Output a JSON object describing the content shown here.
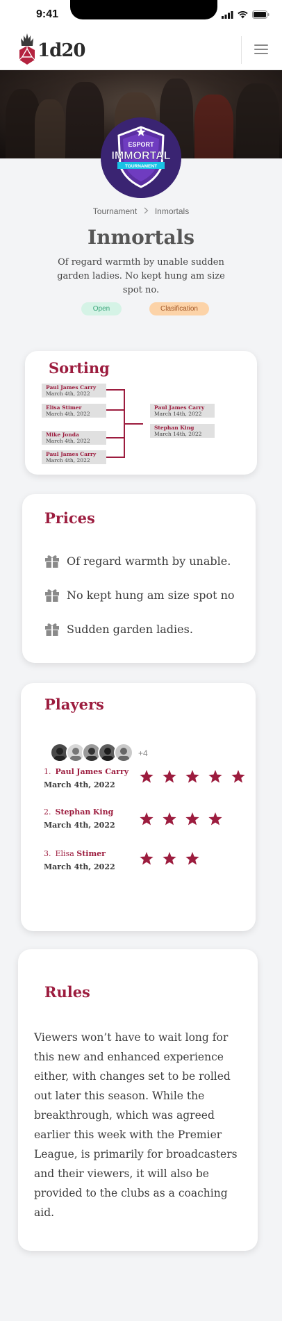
{
  "status_bar": {
    "time": "9:41"
  },
  "header": {
    "logo_text": "1d20",
    "menu_icon": "hamburger-menu-icon"
  },
  "breadcrumb": {
    "parent": "Tournament",
    "current": "Inmortals"
  },
  "team": {
    "name": "Inmortals",
    "description": "Of regard warmth by unable sudden garden ladies. No kept hung am size spot no.",
    "logo": {
      "top": "ESPORT",
      "main": "IMMORTAL",
      "bottom": "TOURNAMENT"
    }
  },
  "badges": {
    "open": "Open",
    "classification": "Clasification"
  },
  "sorting": {
    "title": "Sorting",
    "round1": [
      {
        "name": "Paul James Carry",
        "date": "March 4th, 2022"
      },
      {
        "name": "Elisa Stimer",
        "date": "March 4th, 2022"
      },
      {
        "name": "Mike Jonda",
        "date": "March 4th, 2022"
      },
      {
        "name": "Paul James Carry",
        "date": "March 4th, 2022"
      }
    ],
    "round2": [
      {
        "name": "Paul James Carry",
        "date": "March 14th, 2022"
      },
      {
        "name": "Stephan King",
        "date": "March 14th, 2022"
      }
    ]
  },
  "prices": {
    "title": "Prices",
    "items": [
      "Of regard warmth by unable.",
      "No kept hung am size spot no",
      "Sudden garden ladies."
    ],
    "icon": "gift-icon"
  },
  "players": {
    "title": "Players",
    "more_count": "+4",
    "list": [
      {
        "rank": "1.",
        "first": "Paul",
        "rest": "James Carry",
        "date": "March 4th, 2022",
        "stars": 5
      },
      {
        "rank": "2.",
        "first": "Stephan",
        "rest": "King",
        "date": "March 4th, 2022",
        "stars": 4
      },
      {
        "rank": "3.",
        "first": "Elisa",
        "rest": "Stimer",
        "date": "March 4th, 2022",
        "stars": 3
      }
    ]
  },
  "rules": {
    "title": "Rules",
    "text": "Viewers won’t have to wait long for this new and enhanced experience either, with changes set to be rolled out later this season. While the breakthrough, which was agreed earlier this week with the Premier League, is primarily for broadcasters and their viewers, it will also be provided to the clubs as a coaching aid."
  },
  "colors": {
    "accent": "#9c1c3e",
    "open_bg": "#d5f3e6",
    "class_bg": "#fcd3a8",
    "logo_purple": "#3a2472"
  }
}
